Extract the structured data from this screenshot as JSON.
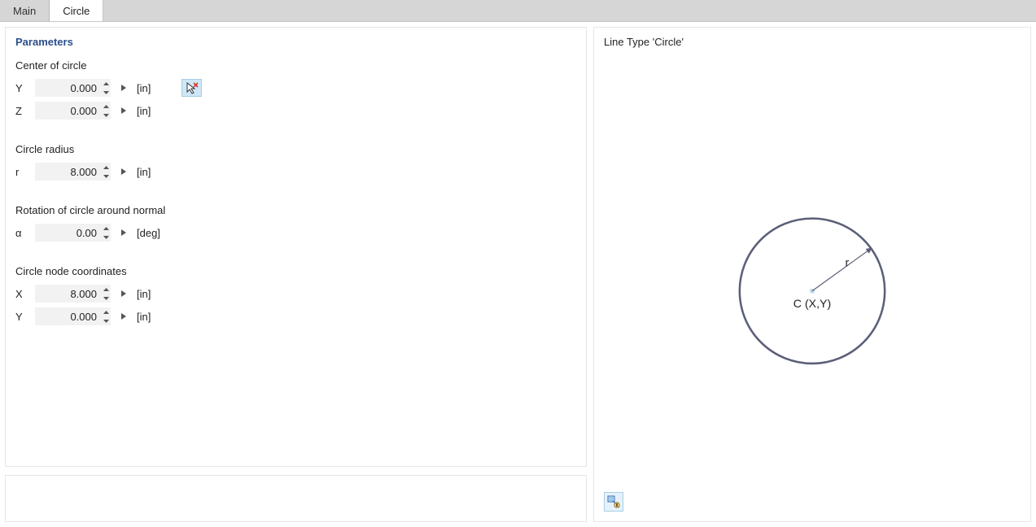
{
  "tabs": {
    "main": "Main",
    "circle": "Circle",
    "active": "circle"
  },
  "section_title": "Parameters",
  "units": {
    "in": "[in]",
    "deg": "[deg]"
  },
  "groups": {
    "center": {
      "label": "Center of circle",
      "y_label": "Y",
      "y_value": "0.000",
      "z_label": "Z",
      "z_value": "0.000"
    },
    "radius": {
      "label": "Circle radius",
      "r_label": "r",
      "r_value": "8.000"
    },
    "rotation": {
      "label": "Rotation of circle around normal",
      "a_label": "α",
      "a_value": "0.00"
    },
    "node": {
      "label": "Circle node coordinates",
      "x_label": "X",
      "x_value": "8.000",
      "y_label": "Y",
      "y_value": "0.000"
    }
  },
  "preview": {
    "title": "Line Type 'Circle'",
    "center_label": "C (X,Y)",
    "radius_label": "r"
  }
}
